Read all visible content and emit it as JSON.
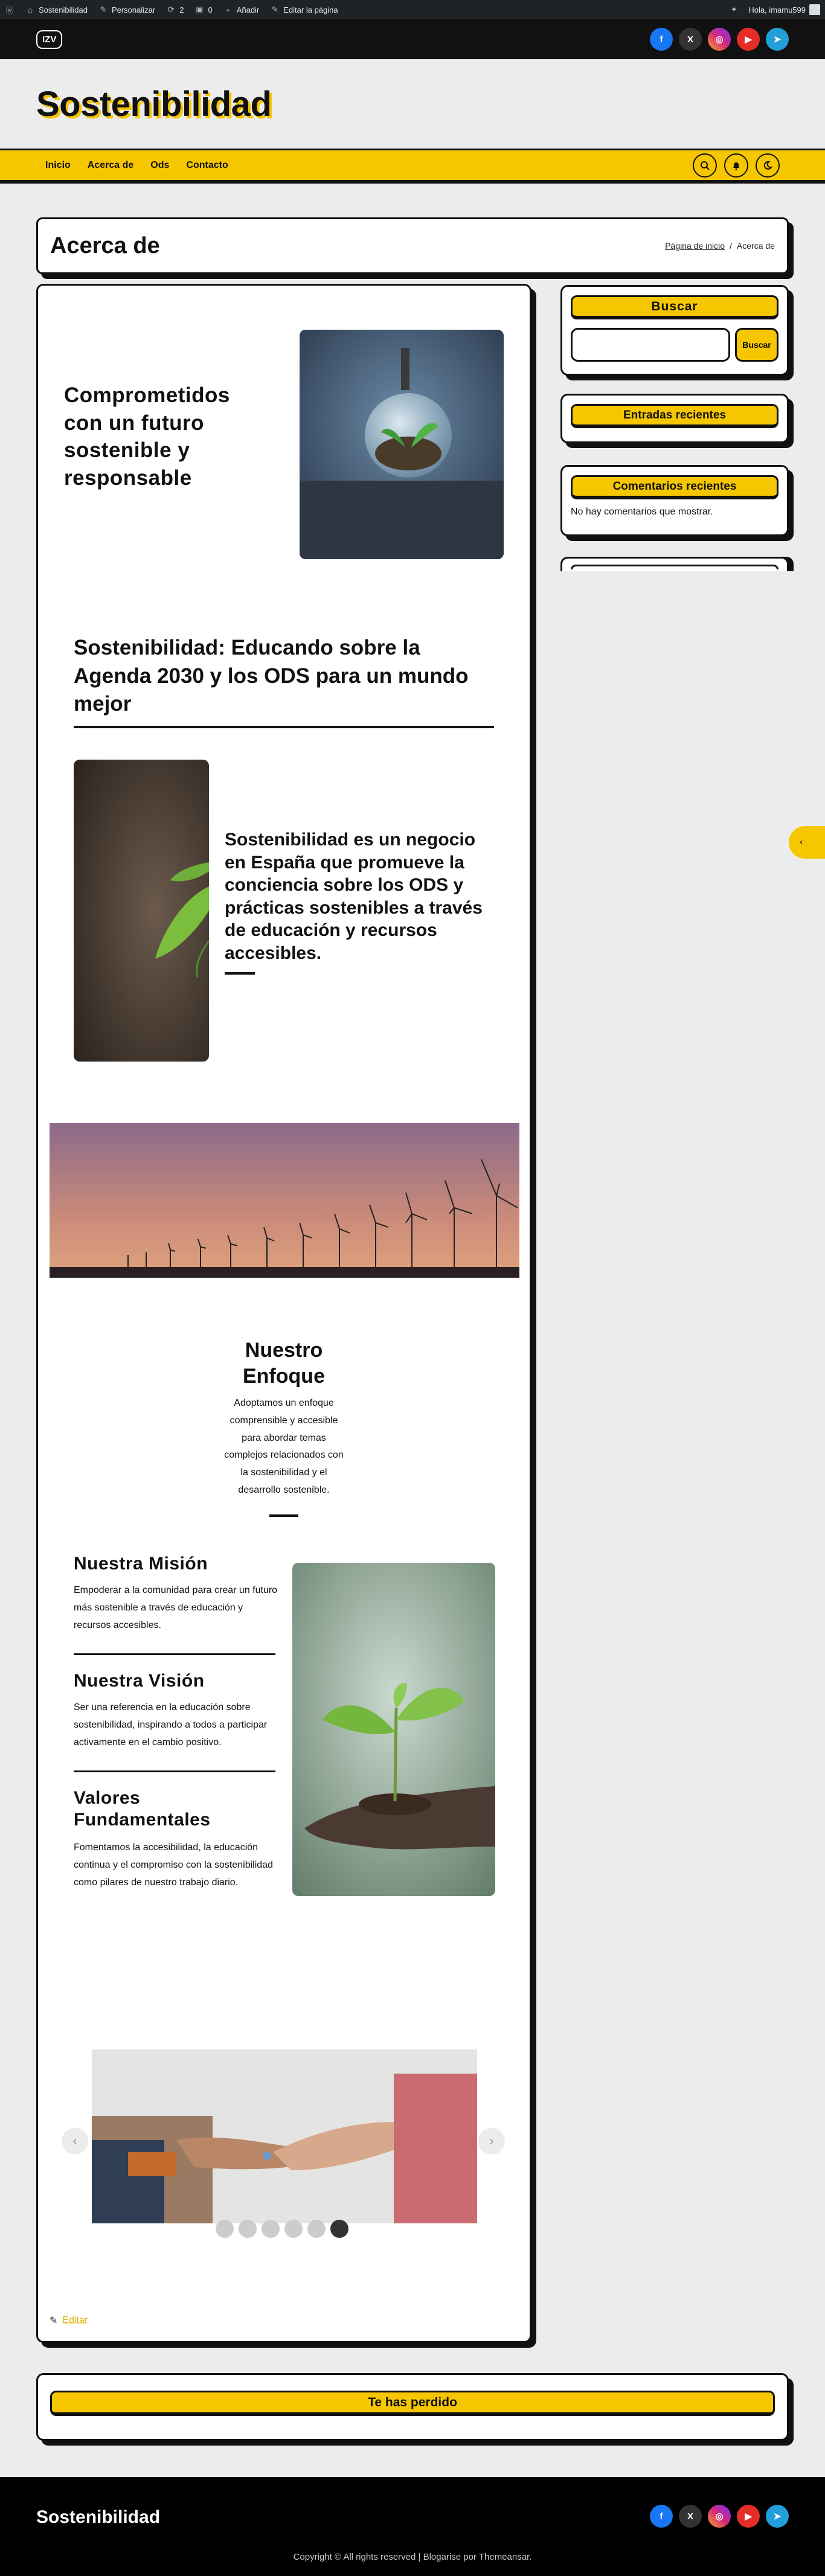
{
  "adminbar": {
    "site": "Sostenibilidad",
    "customize": "Personalizar",
    "updates": "2",
    "comments": "0",
    "new": "Añadir",
    "edit": "Editar la página",
    "greeting": "Hola, imamu599"
  },
  "header": {
    "logo": "IZV",
    "site_title": "Sostenibilidad",
    "socials": [
      {
        "name": "facebook",
        "glyph": "f",
        "color": "#1877f2"
      },
      {
        "name": "x",
        "glyph": "X",
        "color": "#222"
      },
      {
        "name": "instagram",
        "glyph": "◎",
        "color": "#d6297a"
      },
      {
        "name": "youtube",
        "glyph": "▶",
        "color": "#e52d27"
      },
      {
        "name": "telegram",
        "glyph": "➤",
        "color": "#229ed9"
      }
    ]
  },
  "nav": {
    "items": [
      "Inicio",
      "Acerca de",
      "Ods",
      "Contacto"
    ],
    "icons": [
      "search-icon",
      "bell-icon",
      "moon-icon"
    ]
  },
  "page": {
    "title": "Acerca de",
    "breadcrumb_home": "Página de inicio",
    "breadcrumb_sep": "/",
    "breadcrumb_current": "Acerca de"
  },
  "content": {
    "hero_heading": "Comprometidos con un futuro sostenible y responsable",
    "edu_heading": "Sostenibilidad: Educando sobre la Agenda 2030 y los ODS para un mundo mejor",
    "business_heading": "Sostenibilidad es un negocio en España que promueve la conciencia sobre los ODS y prácticas sostenibles a través de educación y recursos accesibles.",
    "enfoque_heading": "Nuestro Enfoque",
    "enfoque_text": "Adoptamos un enfoque comprensible y accesible para abordar temas complejos relacionados con la sostenibilidad y el desarrollo sostenible.",
    "mision_heading": "Nuestra Misión",
    "mision_text": "Empoderar a la comunidad para crear un futuro más sostenible a través de educación y recursos accesibles.",
    "vision_heading": "Nuestra Visión",
    "vision_text": "Ser una referencia en la educación sobre sostenibilidad, inspirando a todos a participar activamente en el cambio positivo.",
    "valores_heading": "Valores Fundamentales",
    "valores_text": "Fomentamos la accesibilidad, la educación continua y el compromiso con la sostenibilidad como pilares de nuestro trabajo diario.",
    "slider_dots": 6,
    "slider_active": 6,
    "edit_label": "Editar"
  },
  "sidebar": {
    "search_title": "Buscar",
    "search_button": "Buscar",
    "recent_posts_title": "Entradas recientes",
    "recent_comments_title": "Comentarios recientes",
    "no_comments": "No hay comentarios que mostrar."
  },
  "lost": {
    "title": "Te has perdido"
  },
  "footer": {
    "title": "Sostenibilidad",
    "copyright": "Copyright © All rights reserved | Blogarise por Themeansar."
  },
  "colors": {
    "accent": "#f6c700",
    "dark": "#111111",
    "background": "#ececec"
  }
}
